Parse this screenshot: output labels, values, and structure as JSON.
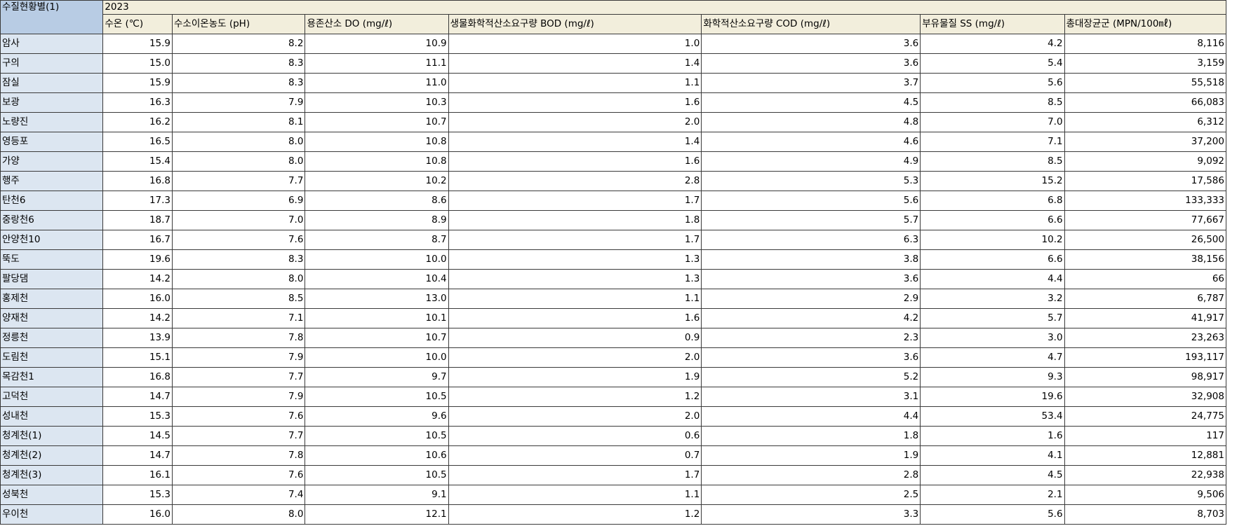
{
  "sheet": {
    "corner_label": "수질현황별(1)",
    "year": "2023",
    "headers": [
      "수온 (℃)",
      "수소이온농도 (pH)",
      "용존산소 DO (mg/ℓ)",
      "생물화학적산소요구량 BOD (mg/ℓ)",
      "화학적산소요구량 COD (mg/ℓ)",
      "부유물질 SS (mg/ℓ)",
      "총대장균군 (MPN/100㎖)"
    ],
    "rows": [
      {
        "name": "암사",
        "values": [
          "15.9",
          "8.2",
          "10.9",
          "1.0",
          "3.6",
          "4.2",
          "8,116"
        ]
      },
      {
        "name": "구의",
        "values": [
          "15.0",
          "8.3",
          "11.1",
          "1.4",
          "3.6",
          "5.4",
          "3,159"
        ]
      },
      {
        "name": "잠실",
        "values": [
          "15.9",
          "8.3",
          "11.0",
          "1.1",
          "3.7",
          "5.6",
          "55,518"
        ]
      },
      {
        "name": "보광",
        "values": [
          "16.3",
          "7.9",
          "10.3",
          "1.6",
          "4.5",
          "8.5",
          "66,083"
        ]
      },
      {
        "name": "노량진",
        "values": [
          "16.2",
          "8.1",
          "10.7",
          "2.0",
          "4.8",
          "7.0",
          "6,312"
        ]
      },
      {
        "name": "영등포",
        "values": [
          "16.5",
          "8.0",
          "10.8",
          "1.4",
          "4.6",
          "7.1",
          "37,200"
        ]
      },
      {
        "name": "가양",
        "values": [
          "15.4",
          "8.0",
          "10.8",
          "1.6",
          "4.9",
          "8.5",
          "9,092"
        ]
      },
      {
        "name": "행주",
        "values": [
          "16.8",
          "7.7",
          "10.2",
          "2.8",
          "5.3",
          "15.2",
          "17,586"
        ]
      },
      {
        "name": "탄천6",
        "values": [
          "17.3",
          "6.9",
          "8.6",
          "1.7",
          "5.6",
          "6.8",
          "133,333"
        ]
      },
      {
        "name": "중랑천6",
        "values": [
          "18.7",
          "7.0",
          "8.9",
          "1.8",
          "5.7",
          "6.6",
          "77,667"
        ]
      },
      {
        "name": "안양천10",
        "values": [
          "16.7",
          "7.6",
          "8.7",
          "1.7",
          "6.3",
          "10.2",
          "26,500"
        ]
      },
      {
        "name": "뚝도",
        "values": [
          "19.6",
          "8.3",
          "10.0",
          "1.3",
          "3.8",
          "6.6",
          "38,156"
        ]
      },
      {
        "name": "팔당댐",
        "values": [
          "14.2",
          "8.0",
          "10.4",
          "1.3",
          "3.6",
          "4.4",
          "66"
        ]
      },
      {
        "name": "홍제천",
        "values": [
          "16.0",
          "8.5",
          "13.0",
          "1.1",
          "2.9",
          "3.2",
          "6,787"
        ]
      },
      {
        "name": "양재천",
        "values": [
          "14.2",
          "7.1",
          "10.1",
          "1.6",
          "4.2",
          "5.7",
          "41,917"
        ]
      },
      {
        "name": "정릉천",
        "values": [
          "13.9",
          "7.8",
          "10.7",
          "0.9",
          "2.3",
          "3.0",
          "23,263"
        ]
      },
      {
        "name": "도림천",
        "values": [
          "15.1",
          "7.9",
          "10.0",
          "2.0",
          "3.6",
          "4.7",
          "193,117"
        ]
      },
      {
        "name": "목감천1",
        "values": [
          "16.8",
          "7.7",
          "9.7",
          "1.9",
          "5.2",
          "9.3",
          "98,917"
        ]
      },
      {
        "name": "고덕천",
        "values": [
          "14.7",
          "7.9",
          "10.5",
          "1.2",
          "3.1",
          "19.6",
          "32,908"
        ]
      },
      {
        "name": "성내천",
        "values": [
          "15.3",
          "7.6",
          "9.6",
          "2.0",
          "4.4",
          "53.4",
          "24,775"
        ]
      },
      {
        "name": "청계천(1)",
        "values": [
          "14.5",
          "7.7",
          "10.5",
          "0.6",
          "1.8",
          "1.6",
          "117"
        ]
      },
      {
        "name": "청계천(2)",
        "values": [
          "14.7",
          "7.8",
          "10.6",
          "0.7",
          "1.9",
          "4.1",
          "12,881"
        ]
      },
      {
        "name": "청계천(3)",
        "values": [
          "16.1",
          "7.6",
          "10.5",
          "1.7",
          "2.8",
          "4.5",
          "22,938"
        ]
      },
      {
        "name": "성북천",
        "values": [
          "15.3",
          "7.4",
          "9.1",
          "1.1",
          "2.5",
          "2.1",
          "9,506"
        ]
      },
      {
        "name": "우이천",
        "values": [
          "16.0",
          "8.0",
          "12.1",
          "1.2",
          "3.3",
          "5.6",
          "8,703"
        ]
      }
    ]
  },
  "colors": {
    "corner_bg": "#b8cce4",
    "row_header_bg": "#dce6f1",
    "column_header_bg": "#f2eedc",
    "grid_line": "#3a3a3a"
  }
}
